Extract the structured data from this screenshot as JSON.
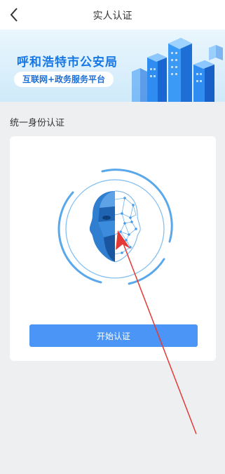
{
  "header": {
    "title": "实人认证",
    "back_icon": "chevron-left-icon"
  },
  "banner": {
    "title": "呼和浩特市公安局",
    "subtitle": "互联网+政务服务平台"
  },
  "section": {
    "label": "统一身份认证"
  },
  "card": {
    "start_button_label": "开始认证",
    "illustration": "face-scan-icon"
  },
  "colors": {
    "accent": "#4a95f5",
    "banner_title": "#1677e6",
    "annotation_arrow": "#e53935"
  }
}
